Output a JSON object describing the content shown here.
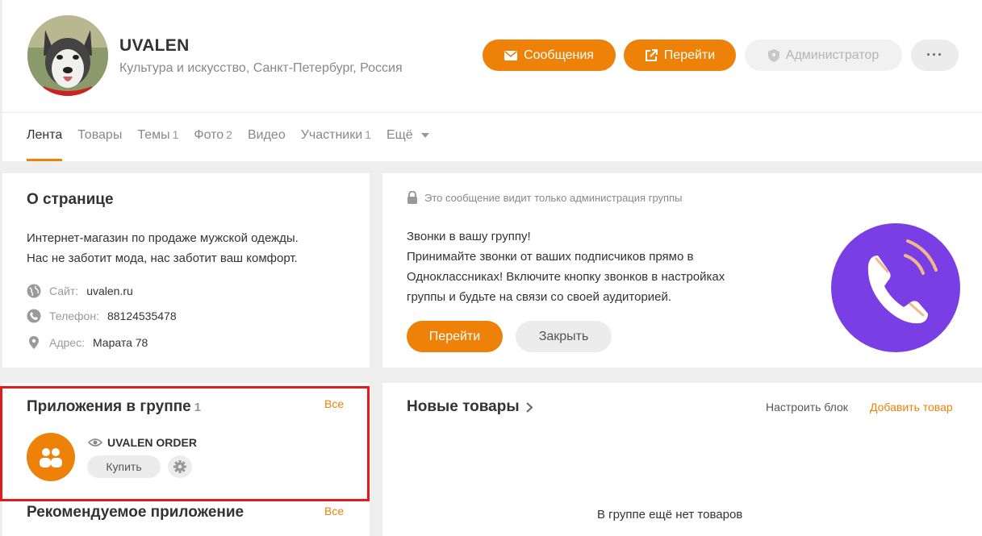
{
  "header": {
    "group_name": "UVALEN",
    "group_subtitle": "Культура и искусство, Санкт-Петербург, Россия",
    "buttons": {
      "messages": "Сообщения",
      "go": "Перейти",
      "admin": "Администратор",
      "more": "···"
    },
    "accent_color": "#ee8208"
  },
  "tabs": [
    {
      "label": "Лента",
      "count": ""
    },
    {
      "label": "Товары",
      "count": ""
    },
    {
      "label": "Темы",
      "count": "1"
    },
    {
      "label": "Фото",
      "count": "2"
    },
    {
      "label": "Видео",
      "count": ""
    },
    {
      "label": "Участники",
      "count": "1"
    },
    {
      "label": "Ещё",
      "count": ""
    }
  ],
  "about": {
    "title": "О странице",
    "description_line1": "Интернет-магазин по продаже мужской одежды.",
    "description_line2": "Нас не заботит мода, нас заботит ваш комфорт.",
    "site_label": "Сайт:",
    "site_value": "uvalen.ru",
    "phone_label": "Телефон:",
    "phone_value": "88124535478",
    "address_label": "Адрес:",
    "address_value": "Марата 78"
  },
  "promo": {
    "notice": "Это сообщение видит только администрация группы",
    "line1": "Звонки в вашу группу!",
    "line2": "Принимайте звонки от ваших подписчиков прямо в",
    "line3": "Одноклассниках! Включите кнопку звонков в настройках",
    "line4": "группы и будьте на связи со своей аудиторией.",
    "go_label": "Перейти",
    "close_label": "Закрыть"
  },
  "apps": {
    "title": "Приложения в группе",
    "count": "1",
    "all_label": "Все",
    "app_name": "UVALEN ORDER",
    "buy_label": "Купить",
    "recommended_title": "Рекомендуемое приложение",
    "recommended_all": "Все"
  },
  "goods": {
    "title": "Новые товары",
    "configure_label": "Настроить блок",
    "add_label": "Добавить товар",
    "empty_text": "В группе ещё нет товаров"
  }
}
